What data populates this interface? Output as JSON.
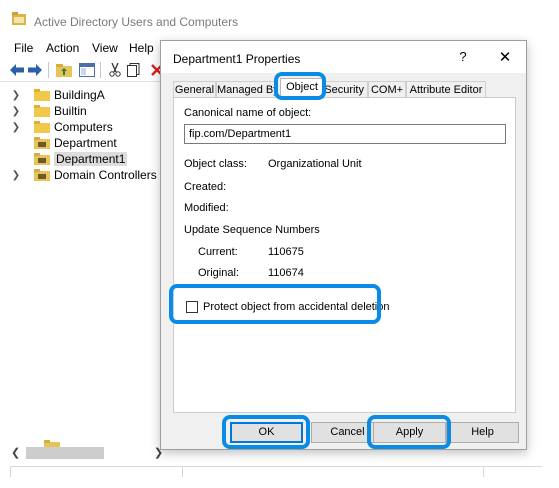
{
  "app": {
    "title": "Active Directory Users and Computers",
    "menu": [
      "File",
      "Action",
      "View",
      "Help"
    ]
  },
  "tree": {
    "items": [
      {
        "label": "BuildingA",
        "expandable": true,
        "selected": false
      },
      {
        "label": "Builtin",
        "expandable": true,
        "selected": false
      },
      {
        "label": "Computers",
        "expandable": true,
        "selected": false
      },
      {
        "label": "Department",
        "expandable": false,
        "selected": false
      },
      {
        "label": "Department1",
        "expandable": false,
        "selected": true
      },
      {
        "label": "Domain Controllers",
        "expandable": true,
        "selected": false
      }
    ]
  },
  "dialog": {
    "title": "Department1 Properties",
    "help_glyph": "?",
    "close_glyph": "✕",
    "tabs": [
      "General",
      "Managed By",
      "Object",
      "Security",
      "COM+",
      "Attribute Editor"
    ],
    "active_tab": "Object",
    "canonical_label": "Canonical name of object:",
    "canonical_value": "fip.com/Department1",
    "object_class_label": "Object class:",
    "object_class_value": "Organizational Unit",
    "created_label": "Created:",
    "modified_label": "Modified:",
    "usn_label": "Update Sequence Numbers",
    "current_label": "Current:",
    "current_value": "110675",
    "original_label": "Original:",
    "original_value": "110674",
    "protect_label": "Protect object from accidental deletion",
    "protect_checked": false,
    "buttons": {
      "ok": "OK",
      "cancel": "Cancel",
      "apply": "Apply",
      "help": "Help"
    }
  },
  "colors": {
    "highlight_ring": "#0a8ce6",
    "folder": "#f2c84b",
    "ou_folder": "#e8c35a"
  }
}
